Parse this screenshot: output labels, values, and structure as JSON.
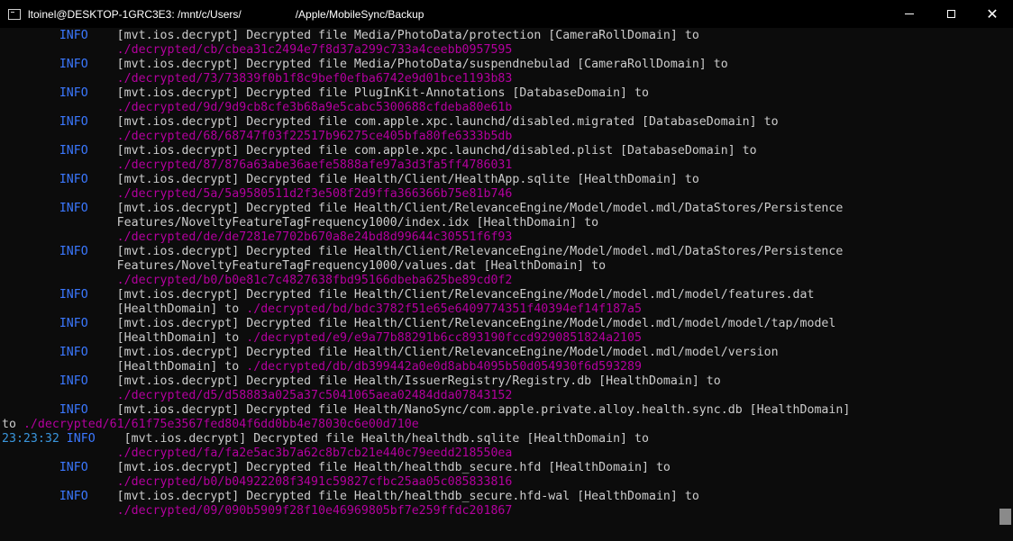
{
  "window": {
    "title": "ltoinel@DESKTOP-1GRC3E3: /mnt/c/Users/                  /Apple/MobileSync/Backup"
  },
  "colors": {
    "background": "#0c0c0c",
    "text": "#cccccc",
    "info_level": "#3b78ff",
    "timestamp": "#3a96dd",
    "decrypted_path": "#b4009e"
  },
  "icons": {
    "app": "terminal-icon",
    "minimize": "minimize-icon",
    "maximize": "maximize-icon",
    "close": "close-icon"
  },
  "lines": [
    {
      "ts": "        ",
      "lvl": "INFO",
      "text": "    [mvt.ios.decrypt] Decrypted file Media/PhotoData/protection [CameraRollDomain] to",
      "path": ""
    },
    {
      "ts": "",
      "lvl": "",
      "text": "                ",
      "path": "./decrypted/cb/cbea31c2494e7f8d37a299c733a4ceebb0957595"
    },
    {
      "ts": "        ",
      "lvl": "INFO",
      "text": "    [mvt.ios.decrypt] Decrypted file Media/PhotoData/suspendnebulad [CameraRollDomain] to",
      "path": ""
    },
    {
      "ts": "",
      "lvl": "",
      "text": "                ",
      "path": "./decrypted/73/73839f0b1f8c9bef0efba6742e9d01bce1193b83"
    },
    {
      "ts": "        ",
      "lvl": "INFO",
      "text": "    [mvt.ios.decrypt] Decrypted file PlugInKit-Annotations [DatabaseDomain] to",
      "path": ""
    },
    {
      "ts": "",
      "lvl": "",
      "text": "                ",
      "path": "./decrypted/9d/9d9cb8cfe3b68a9e5cabc5300688cfdeba80e61b"
    },
    {
      "ts": "        ",
      "lvl": "INFO",
      "text": "    [mvt.ios.decrypt] Decrypted file com.apple.xpc.launchd/disabled.migrated [DatabaseDomain] to",
      "path": ""
    },
    {
      "ts": "",
      "lvl": "",
      "text": "                ",
      "path": "./decrypted/68/68747f03f22517b96275ce405bfa80fe6333b5db"
    },
    {
      "ts": "        ",
      "lvl": "INFO",
      "text": "    [mvt.ios.decrypt] Decrypted file com.apple.xpc.launchd/disabled.plist [DatabaseDomain] to",
      "path": ""
    },
    {
      "ts": "",
      "lvl": "",
      "text": "                ",
      "path": "./decrypted/87/876a63abe36aefe5888afe97a3d3fa5ff4786031"
    },
    {
      "ts": "        ",
      "lvl": "INFO",
      "text": "    [mvt.ios.decrypt] Decrypted file Health/Client/HealthApp.sqlite [HealthDomain] to",
      "path": ""
    },
    {
      "ts": "",
      "lvl": "",
      "text": "                ",
      "path": "./decrypted/5a/5a9580511d2f3e508f2d9ffa366366b75e81b746"
    },
    {
      "ts": "        ",
      "lvl": "INFO",
      "text": "    [mvt.ios.decrypt] Decrypted file Health/Client/RelevanceEngine/Model/model.mdl/DataStores/Persistence",
      "path": ""
    },
    {
      "ts": "",
      "lvl": "",
      "text": "                Features/NoveltyFeatureTagFrequency1000/index.idx [HealthDomain] to",
      "path": ""
    },
    {
      "ts": "",
      "lvl": "",
      "text": "                ",
      "path": "./decrypted/de/de7281e7702b670a8e24bd8d99644c30551f6f93"
    },
    {
      "ts": "        ",
      "lvl": "INFO",
      "text": "    [mvt.ios.decrypt] Decrypted file Health/Client/RelevanceEngine/Model/model.mdl/DataStores/Persistence",
      "path": ""
    },
    {
      "ts": "",
      "lvl": "",
      "text": "                Features/NoveltyFeatureTagFrequency1000/values.dat [HealthDomain] to",
      "path": ""
    },
    {
      "ts": "",
      "lvl": "",
      "text": "                ",
      "path": "./decrypted/b0/b0e81c7c4827638fbd95166dbeba625be89cd0f2"
    },
    {
      "ts": "        ",
      "lvl": "INFO",
      "text": "    [mvt.ios.decrypt] Decrypted file Health/Client/RelevanceEngine/Model/model.mdl/model/features.dat",
      "path": ""
    },
    {
      "ts": "",
      "lvl": "",
      "text": "                [HealthDomain] to ",
      "path": "./decrypted/bd/bdc3782f51e65e6409774351f40394ef14f187a5"
    },
    {
      "ts": "        ",
      "lvl": "INFO",
      "text": "    [mvt.ios.decrypt] Decrypted file Health/Client/RelevanceEngine/Model/model.mdl/model/model/tap/model",
      "path": ""
    },
    {
      "ts": "",
      "lvl": "",
      "text": "                [HealthDomain] to ",
      "path": "./decrypted/e9/e9a77b88291b6cc893190fccd9290851824a2105"
    },
    {
      "ts": "        ",
      "lvl": "INFO",
      "text": "    [mvt.ios.decrypt] Decrypted file Health/Client/RelevanceEngine/Model/model.mdl/model/version",
      "path": ""
    },
    {
      "ts": "",
      "lvl": "",
      "text": "                [HealthDomain] to ",
      "path": "./decrypted/db/db399442a0e0d8abb4095b50d054930f6d593289"
    },
    {
      "ts": "        ",
      "lvl": "INFO",
      "text": "    [mvt.ios.decrypt] Decrypted file Health/IssuerRegistry/Registry.db [HealthDomain] to",
      "path": ""
    },
    {
      "ts": "",
      "lvl": "",
      "text": "                ",
      "path": "./decrypted/d5/d58883a025a37c5041065aea02484dda07843152"
    },
    {
      "ts": "        ",
      "lvl": "INFO",
      "text": "    [mvt.ios.decrypt] Decrypted file Health/NanoSync/com.apple.private.alloy.health.sync.db [HealthDomain]",
      "path": ""
    },
    {
      "ts": "",
      "lvl": "",
      "text": "to ",
      "path": "./decrypted/61/61f75e3567fed804f6dd0bb4e78030c6e00d710e"
    },
    {
      "ts": "23:23:32",
      "lvl": " INFO",
      "text": "    [mvt.ios.decrypt] Decrypted file Health/healthdb.sqlite [HealthDomain] to",
      "path": ""
    },
    {
      "ts": "",
      "lvl": "",
      "text": "                ",
      "path": "./decrypted/fa/fa2e5ac3b7a62c8b7cb21e440c79eedd218550ea"
    },
    {
      "ts": "        ",
      "lvl": "INFO",
      "text": "    [mvt.ios.decrypt] Decrypted file Health/healthdb_secure.hfd [HealthDomain] to",
      "path": ""
    },
    {
      "ts": "",
      "lvl": "",
      "text": "                ",
      "path": "./decrypted/b0/b04922208f3491c59827cfbc25aa05c085833816"
    },
    {
      "ts": "        ",
      "lvl": "INFO",
      "text": "    [mvt.ios.decrypt] Decrypted file Health/healthdb_secure.hfd-wal [HealthDomain] to",
      "path": ""
    },
    {
      "ts": "",
      "lvl": "",
      "text": "                ",
      "path": "./decrypted/09/090b5909f28f10e46969805bf7e259ffdc201867"
    }
  ]
}
